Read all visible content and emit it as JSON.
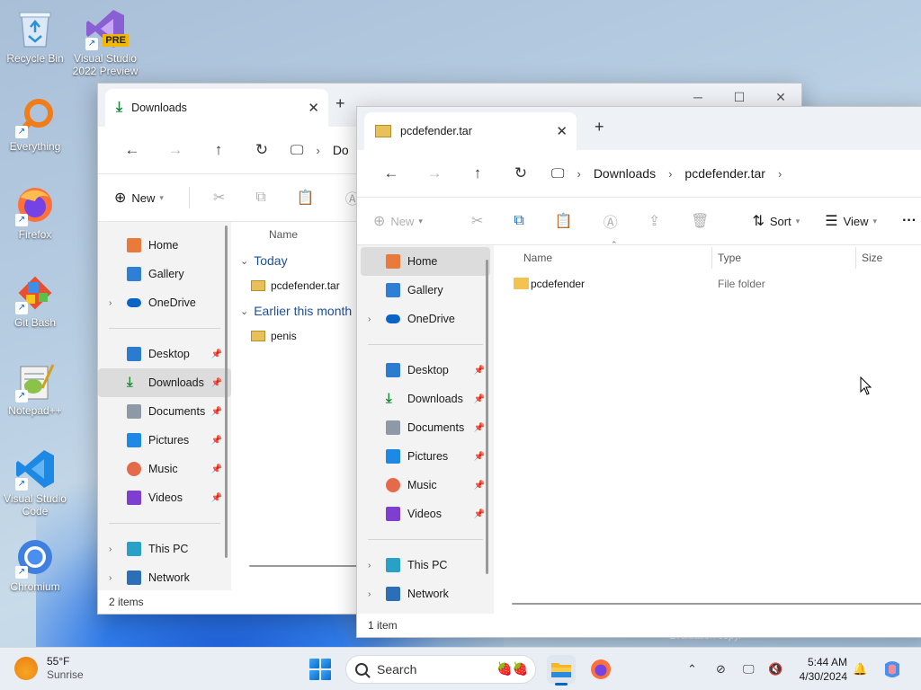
{
  "desktop": {
    "icons": [
      {
        "label": "Recycle Bin",
        "icon": "recycle-bin-icon"
      },
      {
        "label": "Visual Studio 2022 Preview",
        "icon": "visual-studio-icon",
        "badge": "PRE"
      },
      {
        "label": "Everything",
        "icon": "everything-search-icon"
      },
      {
        "label": "Firefox",
        "icon": "firefox-icon"
      },
      {
        "label": "Git Bash",
        "icon": "git-bash-icon"
      },
      {
        "label": "Notepad++",
        "icon": "notepad-plus-plus-icon"
      },
      {
        "label": "Visual Studio Code",
        "icon": "vscode-icon"
      },
      {
        "label": "Chromium",
        "icon": "chromium-icon"
      }
    ],
    "watermark": "Evaluation copy."
  },
  "window_back": {
    "tab_title": "Downloads",
    "address_partial": "Do",
    "toolbar": {
      "new_label": "New"
    },
    "sidebar": {
      "top": [
        {
          "label": "Home",
          "icon": "home-icon"
        },
        {
          "label": "Gallery",
          "icon": "gallery-icon"
        },
        {
          "label": "OneDrive",
          "icon": "onedrive-icon"
        }
      ],
      "quick": [
        {
          "label": "Desktop",
          "icon": "desktop-icon"
        },
        {
          "label": "Downloads",
          "icon": "downloads-icon"
        },
        {
          "label": "Documents",
          "icon": "documents-icon"
        },
        {
          "label": "Pictures",
          "icon": "pictures-icon"
        },
        {
          "label": "Music",
          "icon": "music-icon"
        },
        {
          "label": "Videos",
          "icon": "videos-icon"
        }
      ],
      "bottom": [
        {
          "label": "This PC",
          "icon": "this-pc-icon"
        },
        {
          "label": "Network",
          "icon": "network-icon"
        }
      ]
    },
    "columns": {
      "name": "Name"
    },
    "groups": [
      {
        "label": "Today",
        "items": [
          {
            "name": "pcdefender.tar"
          }
        ]
      },
      {
        "label": "Earlier this month",
        "items": [
          {
            "name": "penis"
          }
        ]
      }
    ],
    "status": "2 items"
  },
  "window_front": {
    "tab_title": "pcdefender.tar",
    "breadcrumbs": [
      "Downloads",
      "pcdefender.tar"
    ],
    "toolbar": {
      "new_label": "New",
      "sort_label": "Sort",
      "view_label": "View",
      "more_label": "···"
    },
    "sidebar": {
      "top": [
        {
          "label": "Home",
          "icon": "home-icon"
        },
        {
          "label": "Gallery",
          "icon": "gallery-icon"
        },
        {
          "label": "OneDrive",
          "icon": "onedrive-icon"
        }
      ],
      "quick": [
        {
          "label": "Desktop",
          "icon": "desktop-icon"
        },
        {
          "label": "Downloads",
          "icon": "downloads-icon"
        },
        {
          "label": "Documents",
          "icon": "documents-icon"
        },
        {
          "label": "Pictures",
          "icon": "pictures-icon"
        },
        {
          "label": "Music",
          "icon": "music-icon"
        },
        {
          "label": "Videos",
          "icon": "videos-icon"
        }
      ],
      "bottom": [
        {
          "label": "This PC",
          "icon": "this-pc-icon"
        },
        {
          "label": "Network",
          "icon": "network-icon"
        }
      ]
    },
    "columns": {
      "name": "Name",
      "type": "Type",
      "size": "Size"
    },
    "rows": [
      {
        "name": "pcdefender",
        "type": "File folder"
      }
    ],
    "status": "1 item"
  },
  "taskbar": {
    "weather_temp": "55°F",
    "weather_desc": "Sunrise",
    "search_placeholder": "Search",
    "time": "5:44 AM",
    "date": "4/30/2024"
  }
}
